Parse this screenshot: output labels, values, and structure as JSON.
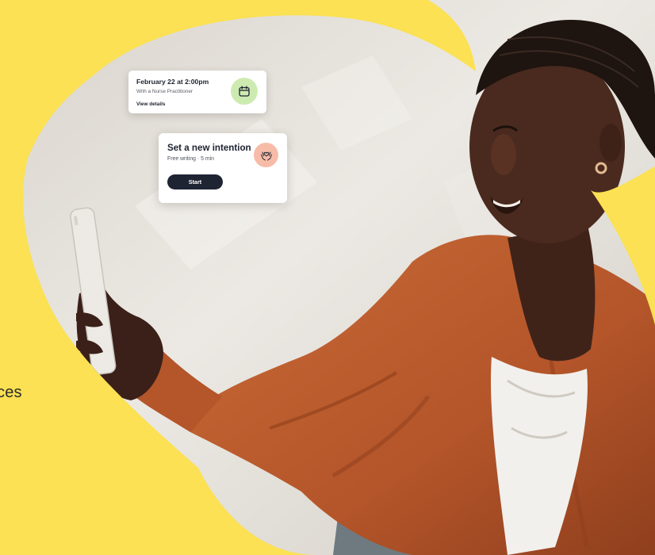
{
  "side_text": "ces",
  "appointment_card": {
    "title": "February 22 at 2:00pm",
    "subtitle": "With a Nurse Practitioner",
    "link_label": "View details",
    "icon": "calendar-icon",
    "icon_bg": "#CDEBB0"
  },
  "intention_card": {
    "title": "Set a new intention",
    "subtitle": "Free writing · 5 min",
    "button_label": "Start",
    "icon": "hands-heart-icon",
    "icon_bg": "#F7BCA8"
  },
  "colors": {
    "background": "#FBE153",
    "wall": "#E7E4DF",
    "jacket": "#B8592A",
    "skin": "#4A2A1E",
    "button": "#1F2433"
  }
}
